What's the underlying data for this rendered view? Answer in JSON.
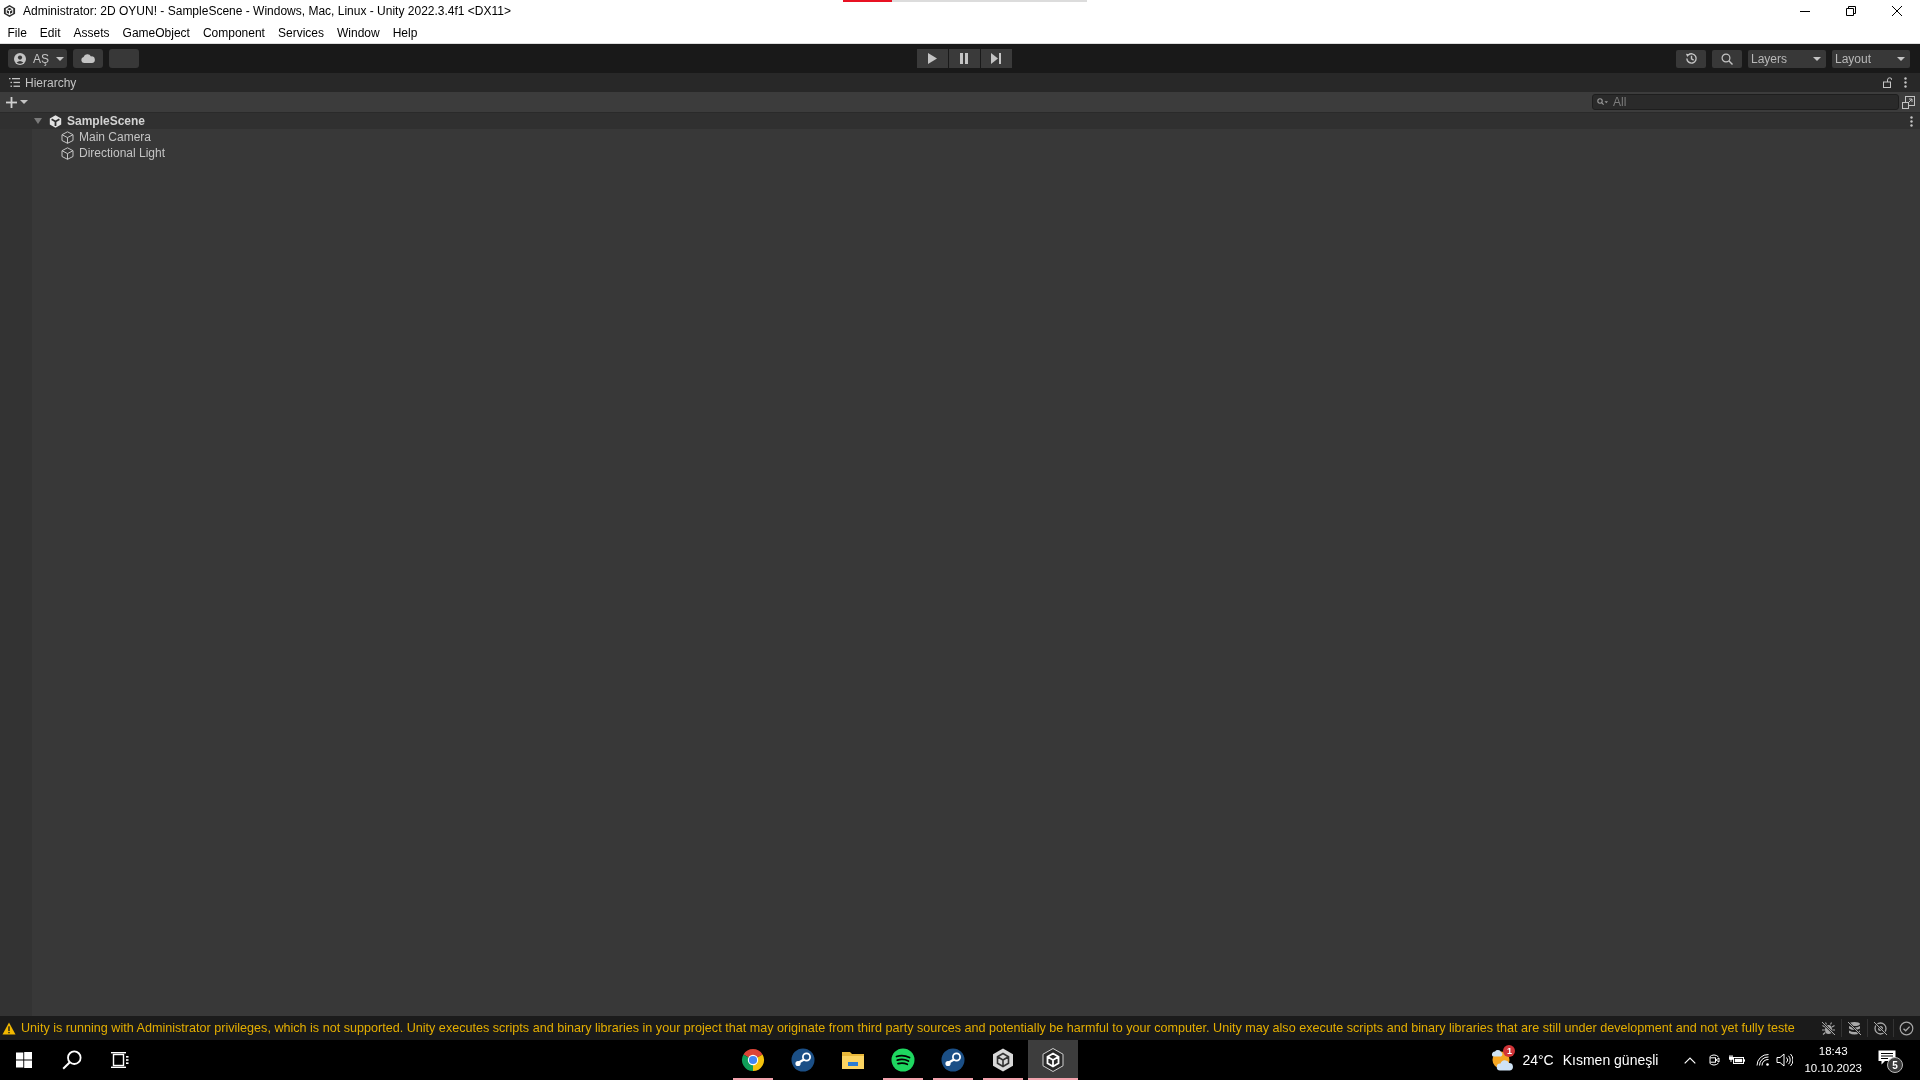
{
  "progress": {
    "level": 0.2
  },
  "window": {
    "title": "Administrator: 2D OYUN! - SampleScene - Windows, Mac, Linux - Unity 2022.3.4f1 <DX11>"
  },
  "menu": [
    "File",
    "Edit",
    "Assets",
    "GameObject",
    "Component",
    "Services",
    "Window",
    "Help"
  ],
  "toolbar": {
    "account": "AŞ",
    "layers": "Layers",
    "layout": "Layout"
  },
  "hierarchy": {
    "title": "Hierarchy",
    "search": {
      "placeholder": "All"
    },
    "scene": {
      "name": "SampleScene",
      "expanded": true,
      "children": [
        {
          "name": "Main Camera"
        },
        {
          "name": "Directional Light"
        }
      ]
    }
  },
  "status_bar": {
    "message": "Unity is running with Administrator privileges, which is not supported. Unity executes scripts and binary libraries in your project that may originate from third party sources and potentially be harmful to your computer. Unity may also execute scripts and binary libraries that are still under development and not yet fully teste"
  },
  "taskbar": {
    "apps": [
      {
        "kind": "chrome",
        "running": true,
        "active": false
      },
      {
        "kind": "steam",
        "running": false,
        "active": false
      },
      {
        "kind": "folder",
        "running": false,
        "active": false
      },
      {
        "kind": "spotify",
        "running": true,
        "active": false
      },
      {
        "kind": "steam",
        "running": true,
        "active": false
      },
      {
        "kind": "unity-hub",
        "running": true,
        "active": false
      },
      {
        "kind": "unity",
        "running": true,
        "active": true
      }
    ],
    "weather": {
      "badge": "1",
      "temperature": "24°C",
      "condition": "Kısmen güneşli"
    },
    "time": "18:43",
    "date": "10.10.2023",
    "notifications": "5"
  }
}
